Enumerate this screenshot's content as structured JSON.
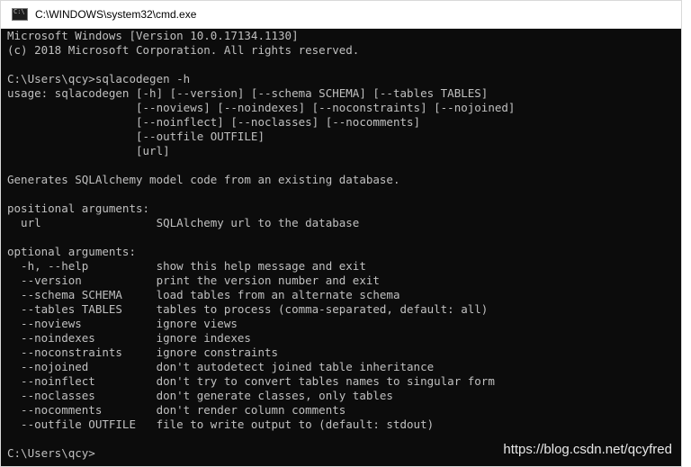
{
  "window": {
    "title": "C:\\WINDOWS\\system32\\cmd.exe"
  },
  "console": {
    "lines": [
      "Microsoft Windows [Version 10.0.17134.1130]",
      "(c) 2018 Microsoft Corporation. All rights reserved.",
      "",
      "C:\\Users\\qcy>sqlacodegen -h",
      "usage: sqlacodegen [-h] [--version] [--schema SCHEMA] [--tables TABLES]",
      "                   [--noviews] [--noindexes] [--noconstraints] [--nojoined]",
      "                   [--noinflect] [--noclasses] [--nocomments]",
      "                   [--outfile OUTFILE]",
      "                   [url]",
      "",
      "Generates SQLAlchemy model code from an existing database.",
      "",
      "positional arguments:",
      "  url                 SQLAlchemy url to the database",
      "",
      "optional arguments:",
      "  -h, --help          show this help message and exit",
      "  --version           print the version number and exit",
      "  --schema SCHEMA     load tables from an alternate schema",
      "  --tables TABLES     tables to process (comma-separated, default: all)",
      "  --noviews           ignore views",
      "  --noindexes         ignore indexes",
      "  --noconstraints     ignore constraints",
      "  --nojoined          don't autodetect joined table inheritance",
      "  --noinflect         don't try to convert tables names to singular form",
      "  --noclasses         don't generate classes, only tables",
      "  --nocomments        don't render column comments",
      "  --outfile OUTFILE   file to write output to (default: stdout)",
      "",
      "C:\\Users\\qcy>"
    ]
  },
  "watermark": "https://blog.csdn.net/qcyfred",
  "colors": {
    "console_bg": "#0c0c0c",
    "console_fg": "#c0c0c0",
    "titlebar_bg": "#ffffff"
  }
}
